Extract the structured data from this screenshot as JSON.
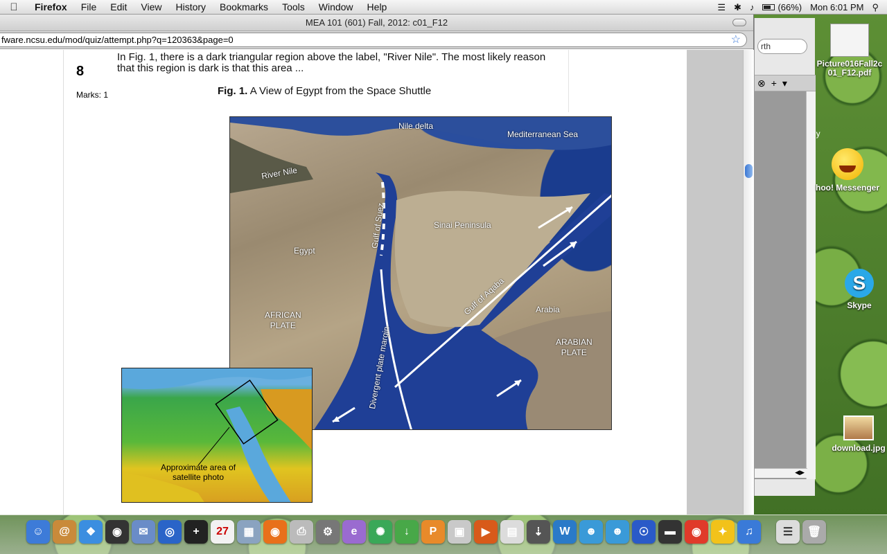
{
  "menubar": {
    "app": "Firefox",
    "items": [
      "File",
      "Edit",
      "View",
      "History",
      "Bookmarks",
      "Tools",
      "Window",
      "Help"
    ],
    "battery": "(66%)",
    "clock": "Mon 6:01 PM"
  },
  "browser": {
    "title": "MEA 101 (601) Fall, 2012: c01_F12",
    "url": "fware.ncsu.edu/mod/quiz/attempt.php?q=120363&page=0"
  },
  "question": {
    "number": "8",
    "marks": "Marks: 1",
    "text": "In Fig. 1, there is a dark triangular region above the label, \"River Nile\". The most likely reason that this region is dark is that this area ...",
    "figure_caption_bold": "Fig. 1.",
    "figure_caption": "A View of Egypt from the Space Shuttle"
  },
  "satellite": {
    "labels": {
      "nile_delta": "Nile delta",
      "med_sea": "Mediterranean Sea",
      "river_nile": "River Nile",
      "gulf_suez": "Gulf of Suez",
      "sinai": "Sinai Peninsula",
      "egypt": "Egypt",
      "gulf_aqaba": "Gulf of Aqaba",
      "arabia": "Arabia",
      "african_plate": "AFRICAN\nPLATE",
      "arabian_plate": "ARABIAN\nPLATE",
      "divergent": "Divergent plate margin"
    }
  },
  "inset": {
    "label": "Approximate area of satellite photo"
  },
  "side_window": {
    "search_text": "rth",
    "partial_text": "gy"
  },
  "desktop_icons": {
    "pdf_file": "Picture016Fall2c01_F12.pdf",
    "yahoo": "hoo! Messenger",
    "skype": "Skype",
    "download": "download.jpg"
  },
  "dock": {
    "apps": [
      "Finder",
      "Address Book",
      "Safari",
      "Dashboard",
      "Mail",
      "Google Earth",
      "Add",
      "iCal",
      "iPhoto",
      "Firefox",
      "Printer",
      "System Preferences",
      "Elements",
      "Link",
      "Downloader",
      "Pages",
      "Image Capture",
      "Keynote",
      "Preview",
      "Downloads",
      "Word",
      "Messenger",
      "Contacts",
      "Network",
      "Scanner",
      "Chrome",
      "AIM",
      "iTunes",
      "Documents",
      "Trash"
    ]
  },
  "colors": {
    "sea": "#1f3f96",
    "link_blue": "#3a78d8"
  }
}
